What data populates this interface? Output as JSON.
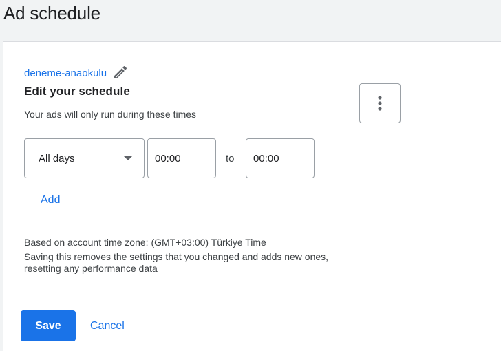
{
  "page": {
    "title": "Ad schedule"
  },
  "campaign": {
    "name": "deneme-anaokulu",
    "edit_icon": "pencil-icon"
  },
  "schedule": {
    "heading": "Edit your schedule",
    "description": "Your ads will only run during these times",
    "more_icon": "more-vert-icon",
    "rows": [
      {
        "day": "All days",
        "start": "00:00",
        "separator": "to",
        "end": "00:00"
      }
    ],
    "add_label": "Add"
  },
  "notes": {
    "timezone": "Based on account time zone: (GMT+03:00) Türkiye Time",
    "warning": "Saving this removes the settings that you changed and adds new ones, resetting any performance data"
  },
  "actions": {
    "save_label": "Save",
    "cancel_label": "Cancel"
  },
  "colors": {
    "accent": "#1a73e8",
    "background": "#f1f3f4",
    "border": "#9aa0a6"
  }
}
